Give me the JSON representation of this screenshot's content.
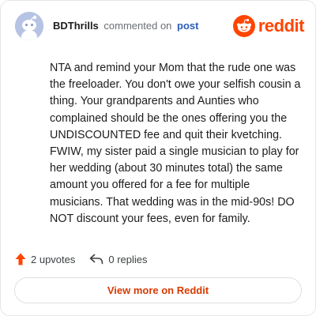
{
  "header": {
    "username": "BDThrills",
    "verb": "commented on",
    "post_link": "post",
    "brand_name": "reddit",
    "brand_color": "#ff4500",
    "avatar_icon": "snoo-avatar-icon"
  },
  "comment": {
    "text": "NTA and remind your Mom that the rude one was the freeloader. You don't owe your selfish cousin a thing. Your grandparents and Aunties who complained should be the ones offering you the UNDISCOUNTED fee and quit their kvetching. FWIW, my sister paid a single musician to play for her wedding (about 30 minutes total) the same amount you offered for a fee for multiple musicians. That wedding was in the mid-90s! DO NOT discount your fees, even for family."
  },
  "actions": {
    "upvotes_label": "2 upvotes",
    "upvote_icon": "upvote-arrow-icon",
    "upvote_color": "#ff4500",
    "replies_label": "0 replies",
    "reply_icon": "reply-arrow-icon"
  },
  "footer": {
    "view_button_label": "View more on Reddit"
  }
}
